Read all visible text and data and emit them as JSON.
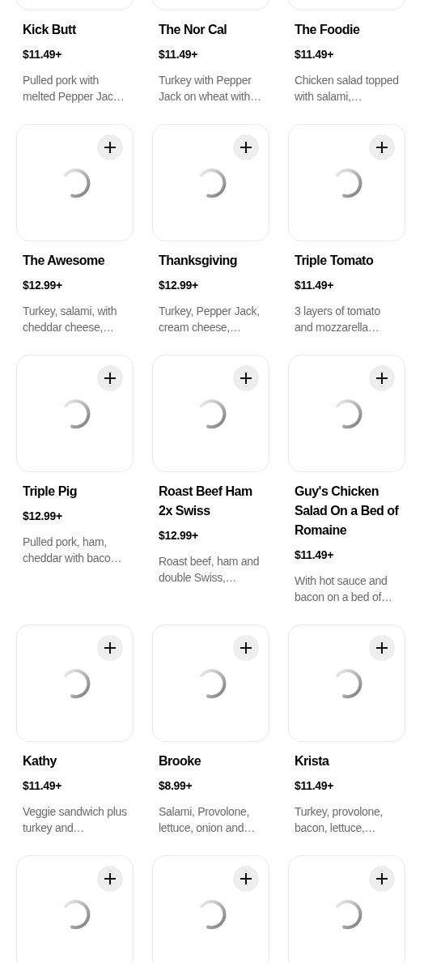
{
  "items": [
    {
      "name": "Kick Butt",
      "price": "$11.49+",
      "description": "Pulled pork with melted Pepper Jac…"
    },
    {
      "name": "The Nor Cal",
      "price": "$11.49+",
      "description": "Turkey with Pepper Jack on wheat with…"
    },
    {
      "name": "The Foodie",
      "price": "$11.49+",
      "description": "Chicken salad topped with salami,…"
    },
    {
      "name": "The Awesome",
      "price": "$12.99+",
      "description": "Turkey, salami, with cheddar cheese,…",
      "loading": true
    },
    {
      "name": "Thanksgiving",
      "price": "$12.99+",
      "description": "Turkey, Pepper Jack, cream cheese,…",
      "loading": true
    },
    {
      "name": "Triple Tomato",
      "price": "$11.49+",
      "description": "3 layers of tomato and mozzarella…",
      "loading": true
    },
    {
      "name": "Triple Pig",
      "price": "$12.99+",
      "description": "Pulled pork, ham, cheddar with baco…",
      "loading": true
    },
    {
      "name": "Roast Beef Ham 2x Swiss",
      "price": "$12.99+",
      "description": "Roast beef, ham and double Swiss,…",
      "loading": true
    },
    {
      "name": "Guy's Chicken Salad On a Bed of Romaine",
      "price": "$11.49+",
      "description": "With hot sauce and bacon on a bed of…",
      "loading": true
    },
    {
      "name": "Kathy",
      "price": "$11.49+",
      "description": "Veggie sandwich plus turkey and…",
      "loading": true
    },
    {
      "name": "Brooke",
      "price": "$8.99+",
      "description": "Salami, Provolone, lettuce, onion and…",
      "loading": true
    },
    {
      "name": "Krista",
      "price": "$11.49+",
      "description": "Turkey, provolone, bacon, lettuce,…",
      "loading": true
    },
    {
      "loading": true
    },
    {
      "loading": true
    },
    {
      "loading": true
    }
  ]
}
